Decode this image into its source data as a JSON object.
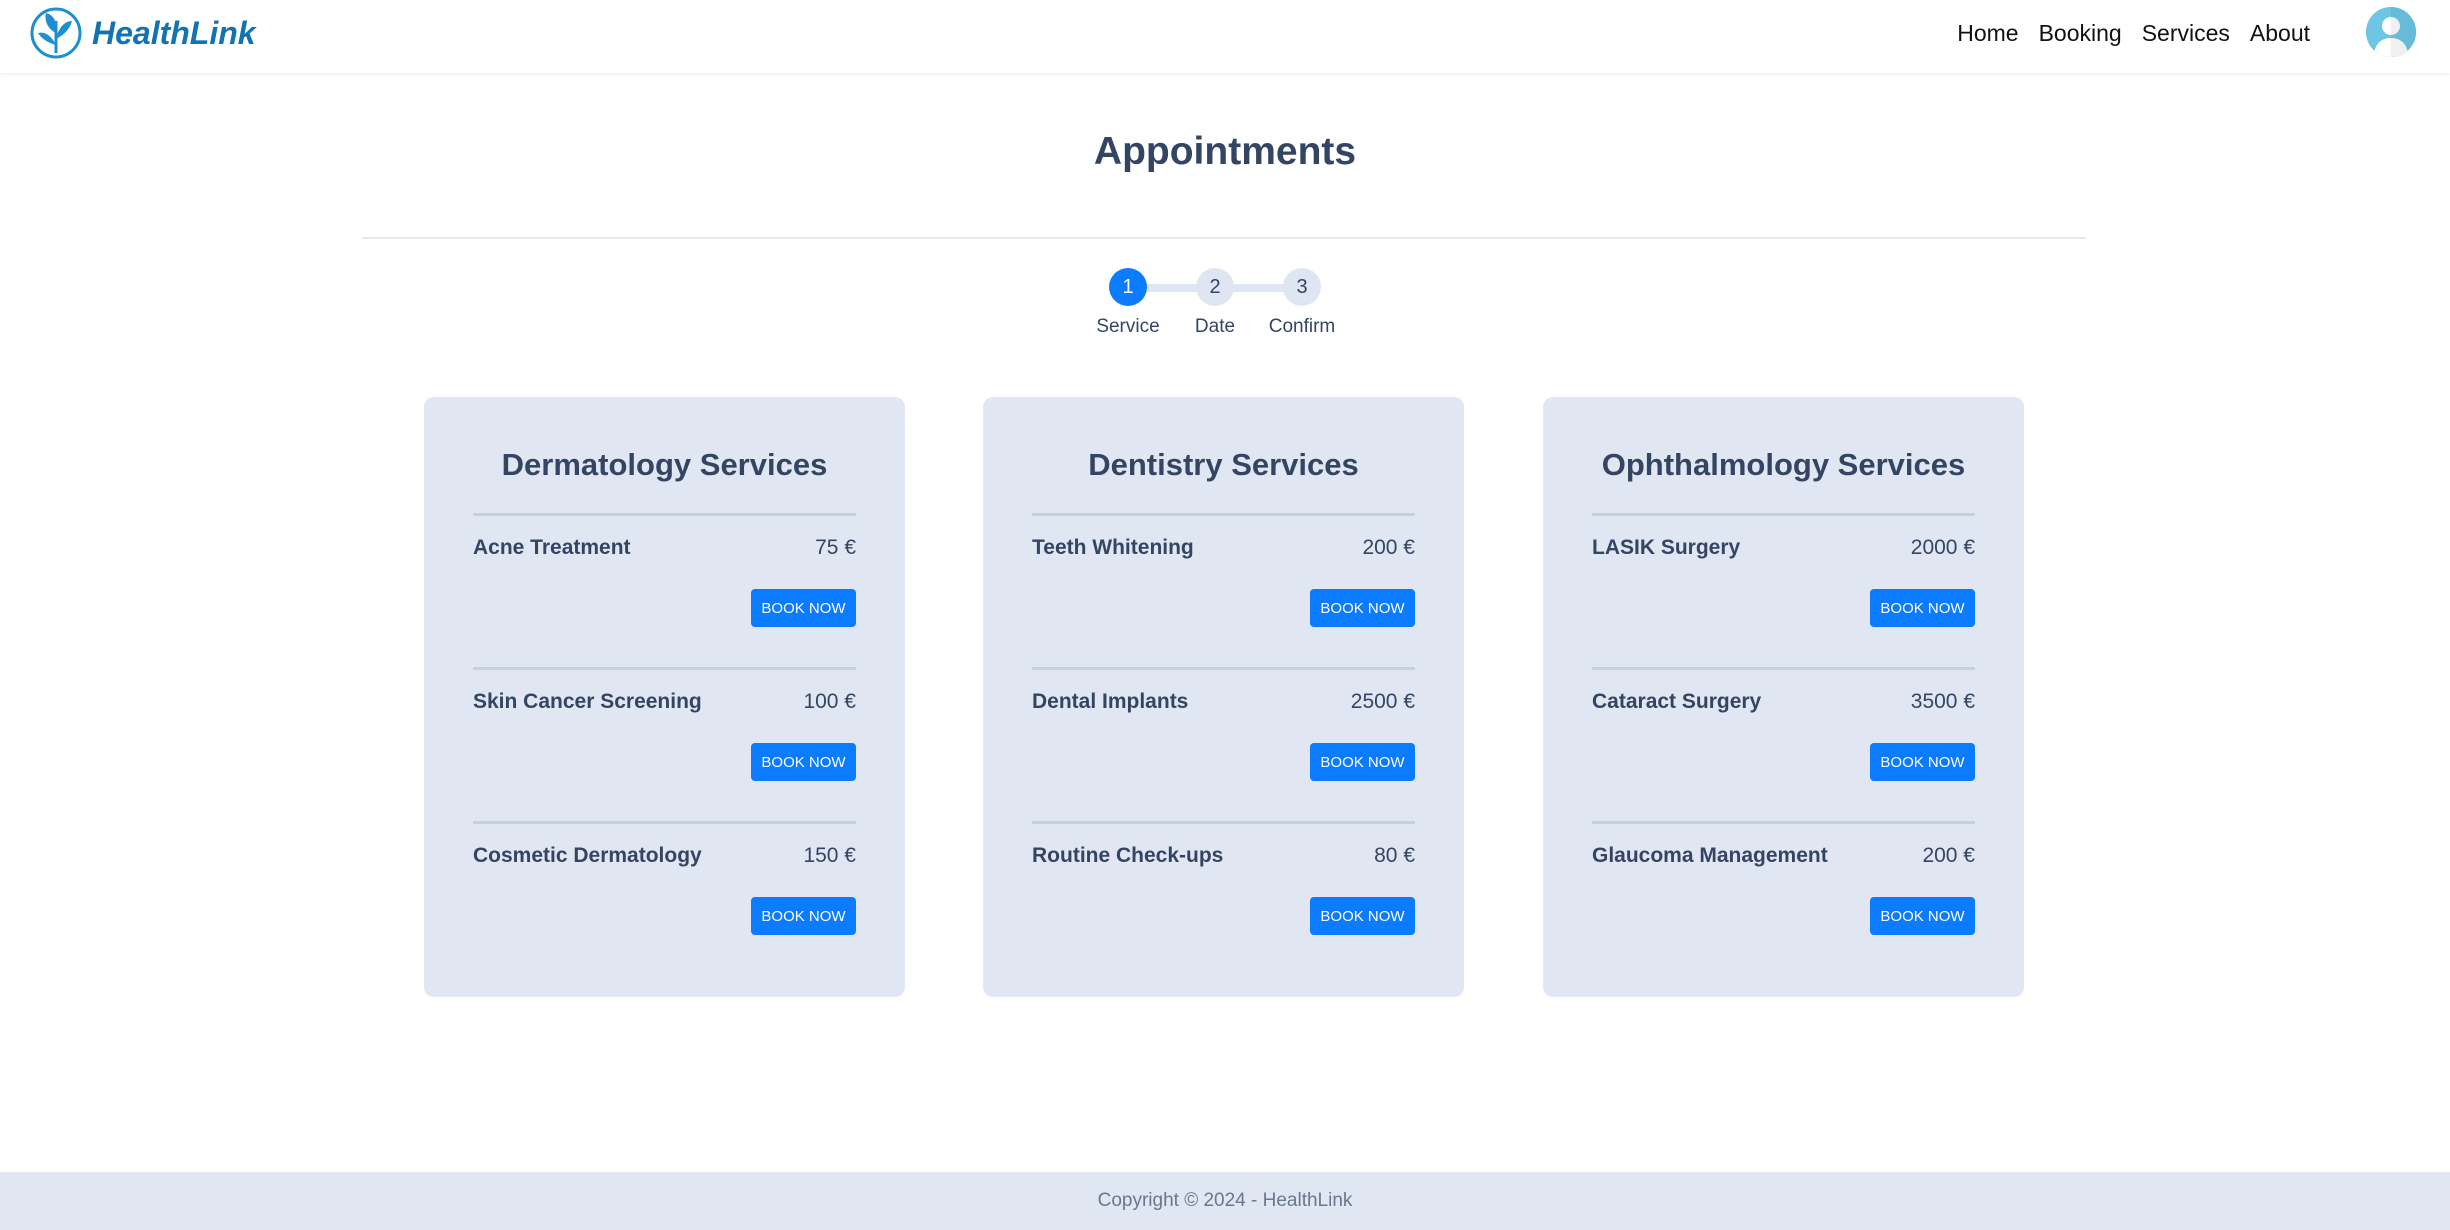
{
  "brand": {
    "name": "HealthLink",
    "logo_icon": "leaf-logo-icon",
    "color": "#1172b6"
  },
  "nav": {
    "links": [
      {
        "label": "Home"
      },
      {
        "label": "Booking"
      },
      {
        "label": "Services"
      },
      {
        "label": "About"
      }
    ],
    "avatar_icon": "user-avatar-icon"
  },
  "page": {
    "title": "Appointments"
  },
  "stepper": {
    "steps": [
      {
        "number": "1",
        "label": "Service",
        "active": true
      },
      {
        "number": "2",
        "label": "Date",
        "active": false
      },
      {
        "number": "3",
        "label": "Confirm",
        "active": false
      }
    ],
    "active_color": "#0b7bff"
  },
  "cards": [
    {
      "title": "Dermatology Services",
      "items": [
        {
          "name": "Acne Treatment",
          "price": "75 €",
          "button": "BOOK NOW"
        },
        {
          "name": "Skin Cancer Screening",
          "price": "100 €",
          "button": "BOOK NOW"
        },
        {
          "name": "Cosmetic Dermatology",
          "price": "150 €",
          "button": "BOOK NOW"
        }
      ]
    },
    {
      "title": "Dentistry Services",
      "items": [
        {
          "name": "Teeth Whitening",
          "price": "200 €",
          "button": "BOOK NOW"
        },
        {
          "name": "Dental Implants",
          "price": "2500 €",
          "button": "BOOK NOW"
        },
        {
          "name": "Routine Check-ups",
          "price": "80 €",
          "button": "BOOK NOW"
        }
      ]
    },
    {
      "title": "Ophthalmology Services",
      "items": [
        {
          "name": "LASIK Surgery",
          "price": "2000 €",
          "button": "BOOK NOW"
        },
        {
          "name": "Cataract Surgery",
          "price": "3500 €",
          "button": "BOOK NOW"
        },
        {
          "name": "Glaucoma Management",
          "price": "200 €",
          "button": "BOOK NOW"
        }
      ]
    }
  ],
  "footer": {
    "text": "Copyright © 2024 - HealthLink"
  },
  "colors": {
    "primary": "#0b7bff",
    "card_bg": "#e0e7f3",
    "text": "#344563"
  }
}
